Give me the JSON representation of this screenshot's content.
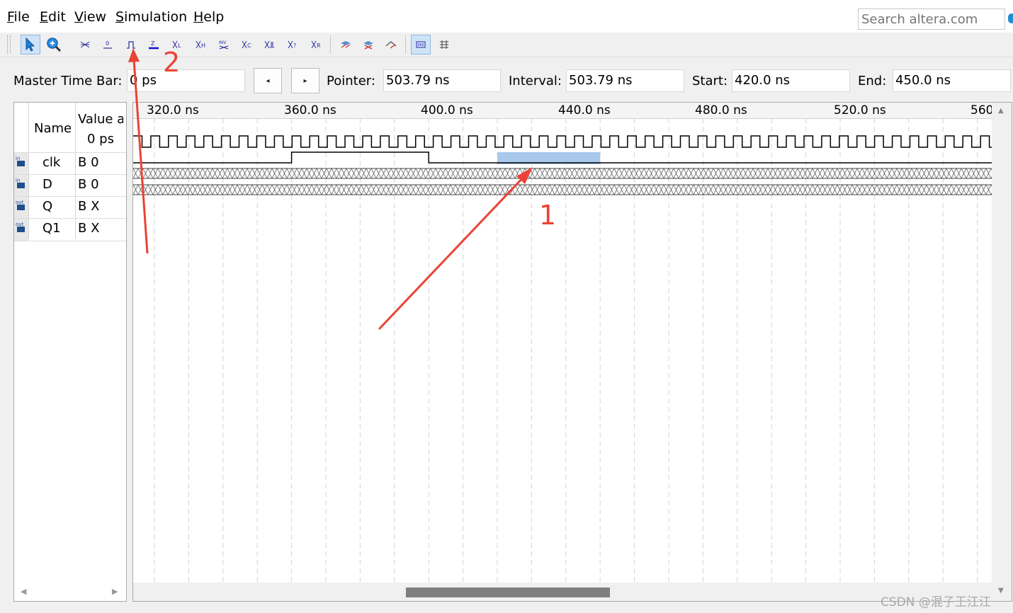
{
  "menu": {
    "file": {
      "key": "F",
      "rest": "ile"
    },
    "edit": {
      "key": "E",
      "rest": "dit"
    },
    "view": {
      "key": "V",
      "rest": "iew"
    },
    "simulation": {
      "key": "S",
      "rest": "imulation"
    },
    "help": {
      "key": "H",
      "rest": "elp"
    }
  },
  "search": {
    "placeholder": "Search altera.com"
  },
  "toolbar": {
    "buttons": [
      {
        "icon": "selection-pointer-icon"
      },
      {
        "icon": "zoom-tool-icon"
      },
      {
        "icon": "forcing-unknown-icon"
      },
      {
        "icon": "forcing-low-icon"
      },
      {
        "icon": "forcing-high-icon"
      },
      {
        "icon": "high-impedance-icon"
      },
      {
        "icon": "weak-low-icon"
      },
      {
        "icon": "weak-high-icon"
      },
      {
        "icon": "invert-icon"
      },
      {
        "icon": "count-value-icon"
      },
      {
        "icon": "clock-value-icon"
      },
      {
        "icon": "arbitrary-value-icon"
      },
      {
        "icon": "random-value-icon"
      },
      {
        "icon": "functional-simulation-icon"
      },
      {
        "icon": "timing-simulation-icon"
      },
      {
        "icon": "netlist-simulation-icon"
      },
      {
        "icon": "snap-to-grid-icon"
      },
      {
        "icon": "grid-settings-icon"
      }
    ]
  },
  "timebar": {
    "master_label": "Master Time Bar:",
    "master_value": "0 ps",
    "prev_glyph": "◂",
    "next_glyph": "▸",
    "pointer_label": "Pointer:",
    "pointer_value": "503.79 ns",
    "interval_label": "Interval:",
    "interval_value": "503.79 ns",
    "start_label": "Start:",
    "start_value": "420.0 ns",
    "end_label": "End:",
    "end_value": "450.0 ns"
  },
  "signals": {
    "header_name": "Name",
    "header_value_line1": "Value a",
    "header_value_line2": "0 ps",
    "rows": [
      {
        "type": "in",
        "name": "clk",
        "value": "B 0"
      },
      {
        "type": "in",
        "name": "D",
        "value": "B 0"
      },
      {
        "type": "out",
        "name": "Q",
        "value": "B X"
      },
      {
        "type": "out",
        "name": "Q1",
        "value": "B X"
      }
    ]
  },
  "ruler": {
    "ticks": [
      "320.0 ns",
      "360.0 ns",
      "400.0 ns",
      "440.0 ns",
      "480.0 ns",
      "520.0 ns",
      "560"
    ]
  },
  "waveforms": {
    "clk": {
      "pattern": "clock"
    },
    "D": {
      "levels": [
        0,
        1,
        0
      ],
      "selection": {
        "start_ns": 420.0,
        "end_ns": 450.0
      }
    },
    "Q": {
      "state": "unknown"
    },
    "Q1": {
      "state": "unknown"
    }
  },
  "annotations": {
    "label1": "1",
    "label2": "2",
    "arrow_color": "#ea4335"
  },
  "watermark": "CSDN @混子王江江"
}
